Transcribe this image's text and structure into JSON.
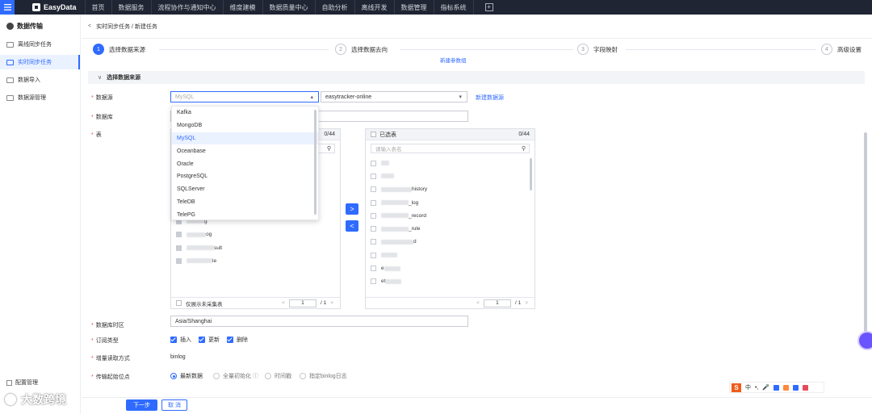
{
  "topbar": {
    "brand": "EasyData",
    "nav": [
      "首页",
      "数据服务",
      "流程协作与通知中心",
      "维度建模",
      "数据质量中心",
      "自助分析",
      "离线开发",
      "数据管理",
      "指标系统"
    ]
  },
  "sidebar": {
    "title": "数据传输",
    "items": [
      "离线同步任务",
      "实时同步任务",
      "数据导入",
      "数据源管理"
    ],
    "bottom_item": "配置管理",
    "watermark": "大数跨境"
  },
  "breadcrumb": "实时同步任务 / 新建任务",
  "steps": [
    {
      "num": "1",
      "label": "选择数据来源"
    },
    {
      "num": "2",
      "label": "选择数据去向"
    },
    {
      "num": "3",
      "label": "字段映射"
    },
    {
      "num": "4",
      "label": "高级设置"
    }
  ],
  "new_param_group": "新建参数组",
  "section_title": "选择数据来源",
  "form": {
    "datasource_label": "数据源",
    "datasource_placeholder": "MySQL",
    "datasource_instance": "easytracker-online",
    "new_datasource_link": "新建数据源",
    "database_label": "数据库",
    "table_label": "表",
    "timezone_label": "数据库时区",
    "timezone_value": "Asia/Shanghai",
    "subscribe_label": "订阅类型",
    "subscribe_options": [
      "插入",
      "更新",
      "删除"
    ],
    "read_mode_label": "增量读取方式",
    "read_mode_value": "binlog",
    "start_label": "传输起始位点",
    "start_options": [
      "最新数据",
      "全量初始化",
      "时间戳",
      "指定binlog日志"
    ]
  },
  "dropdown": {
    "options": [
      "Kafka",
      "MongoDB",
      "MySQL",
      "Oceanbase",
      "Oracle",
      "PostgreSQL",
      "SQLServer",
      "TeleDB",
      "TelePG"
    ],
    "selected": "MySQL"
  },
  "left_box": {
    "count": "0/44",
    "rows": [
      "r",
      "g",
      "og",
      "sult",
      "le"
    ],
    "footer_check": "仅展示未采集表",
    "page": "1",
    "total": "/ 1"
  },
  "right_box": {
    "header": "已选表",
    "count": "0/44",
    "search_placeholder": "请输入表名",
    "rows": [
      "",
      "",
      "history",
      "_log",
      "_record",
      "_rule",
      "d",
      "",
      "e",
      "et"
    ],
    "page": "1",
    "total": "/ 1"
  },
  "transfer": {
    "right_arrow": ">",
    "left_arrow": "<"
  },
  "buttons": {
    "next": "下一步",
    "cancel": "取 消"
  },
  "ime": {
    "logo": "S",
    "lang": "中"
  }
}
